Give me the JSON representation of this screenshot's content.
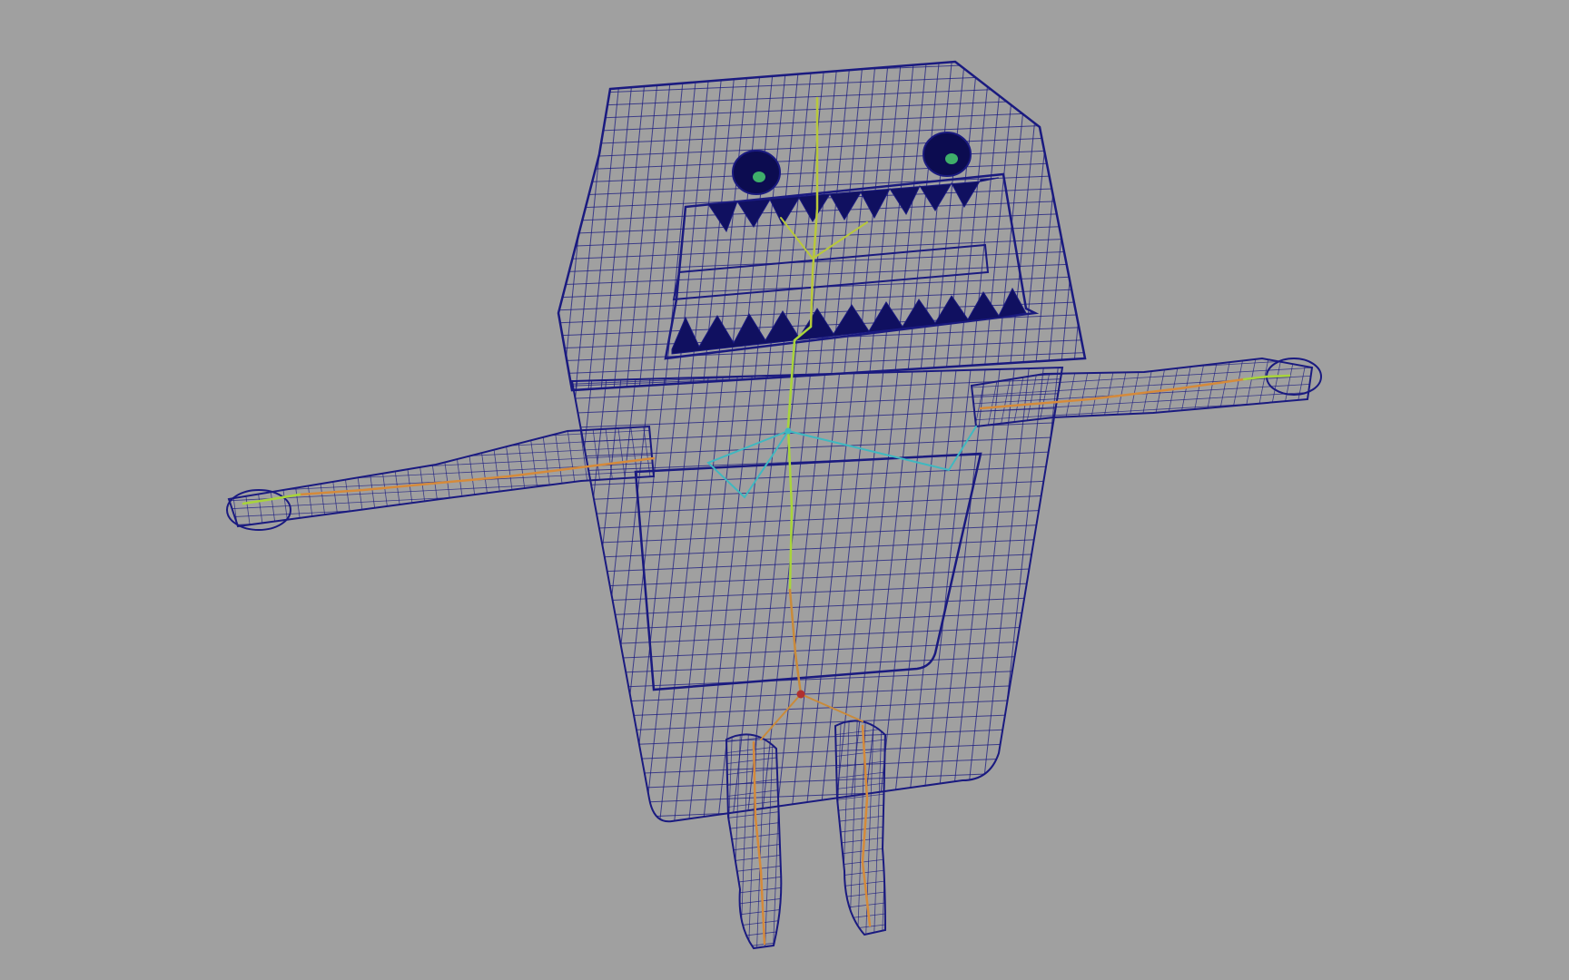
{
  "viewport": {
    "background_color": "#a0a0a0",
    "display_mode": "wireframe"
  },
  "model": {
    "wire_color": "#1a1a80",
    "tooth_fill": "#101060",
    "eye_fill": "#0c0c50",
    "eye_highlight_color": "#3fae6a"
  },
  "skeleton": {
    "spine_color": "#b8c83a",
    "spine_lower_color": "#c98a3a",
    "limb_color": "#d58a3a",
    "clavicle_color": "#3fb8c0",
    "hand_color": "#a8d43a"
  }
}
